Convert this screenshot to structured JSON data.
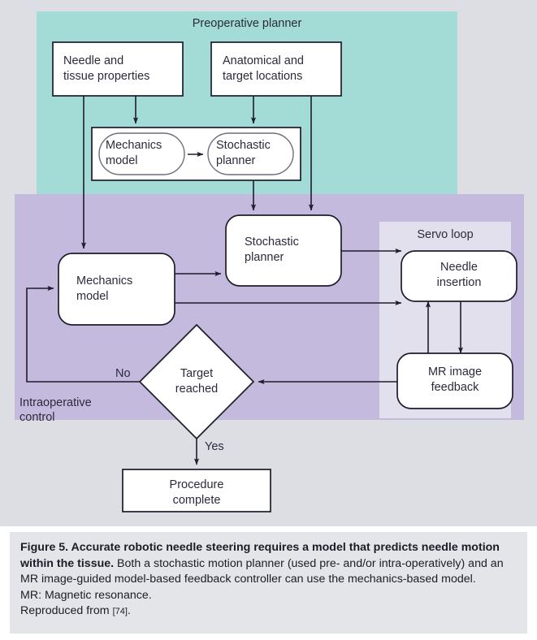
{
  "figure": {
    "background_color": "#dddee3",
    "caption_background": "#e4e5e9"
  },
  "panels": [
    {
      "id": "preoperative-planner",
      "title": "Preoperative planner",
      "color": "#a3dcd6"
    },
    {
      "id": "intraoperative-control",
      "title": "Intraoperative\ncontrol",
      "color": "#c4bade"
    },
    {
      "id": "servo-loop",
      "title": "Servo loop",
      "color": "#e3e0ee"
    }
  ],
  "nodes": {
    "needle_tissue_properties": {
      "label": "Needle and\ntissue properties",
      "shape": "rect"
    },
    "anatomical_target_locations": {
      "label": "Anatomical and\ntarget locations",
      "shape": "rect"
    },
    "planner_mechanics_model": {
      "label": "Mechanics\nmodel",
      "shape": "pill"
    },
    "planner_stochastic_planner": {
      "label": "Stochastic\nplanner",
      "shape": "pill"
    },
    "control_mechanics_model": {
      "label": "Mechanics\nmodel",
      "shape": "rounded"
    },
    "control_stochastic_planner": {
      "label": "Stochastic\nplanner",
      "shape": "rounded"
    },
    "needle_insertion": {
      "label": "Needle\ninsertion",
      "shape": "rounded"
    },
    "mr_image_feedback": {
      "label": "MR image\nfeedback",
      "shape": "rounded"
    },
    "target_reached": {
      "label": "Target\nreached",
      "shape": "diamond"
    },
    "procedure_complete": {
      "label": "Procedure\ncomplete",
      "shape": "rect"
    }
  },
  "edge_labels": {
    "no": "No",
    "yes": "Yes"
  },
  "caption": {
    "bold_part": "Figure 5. Accurate robotic needle steering requires a model that predicts needle motion within the tissue.",
    "body_part": " Both a stochastic motion planner (used pre- and/or intra-operatively) and an MR image-guided model-based feedback controller can use the mechanics-based model.",
    "abbreviation_line": "MR: Magnetic resonance.",
    "reproduced_prefix": "Reproduced from ",
    "reproduced_ref": "[74]",
    "reproduced_suffix": "."
  }
}
